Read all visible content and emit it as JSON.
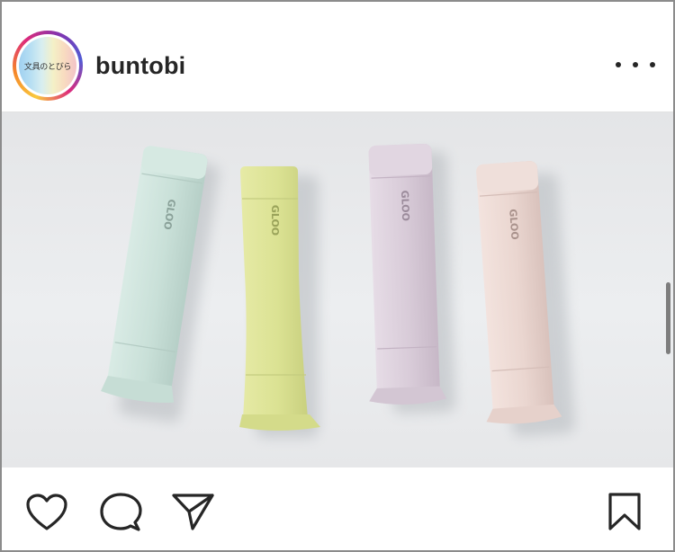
{
  "post": {
    "username": "buntobi",
    "avatar_text": "文具のとびら",
    "product_brand_text": "GLOO",
    "product_colors": [
      "#cfe3dc",
      "#dfe59a",
      "#dcd0dd",
      "#ecd9d4"
    ]
  },
  "icons": {
    "more": "more-horizontal-icon",
    "like": "heart-icon",
    "comment": "comment-bubble-icon",
    "share": "paper-plane-icon",
    "save": "bookmark-icon"
  }
}
